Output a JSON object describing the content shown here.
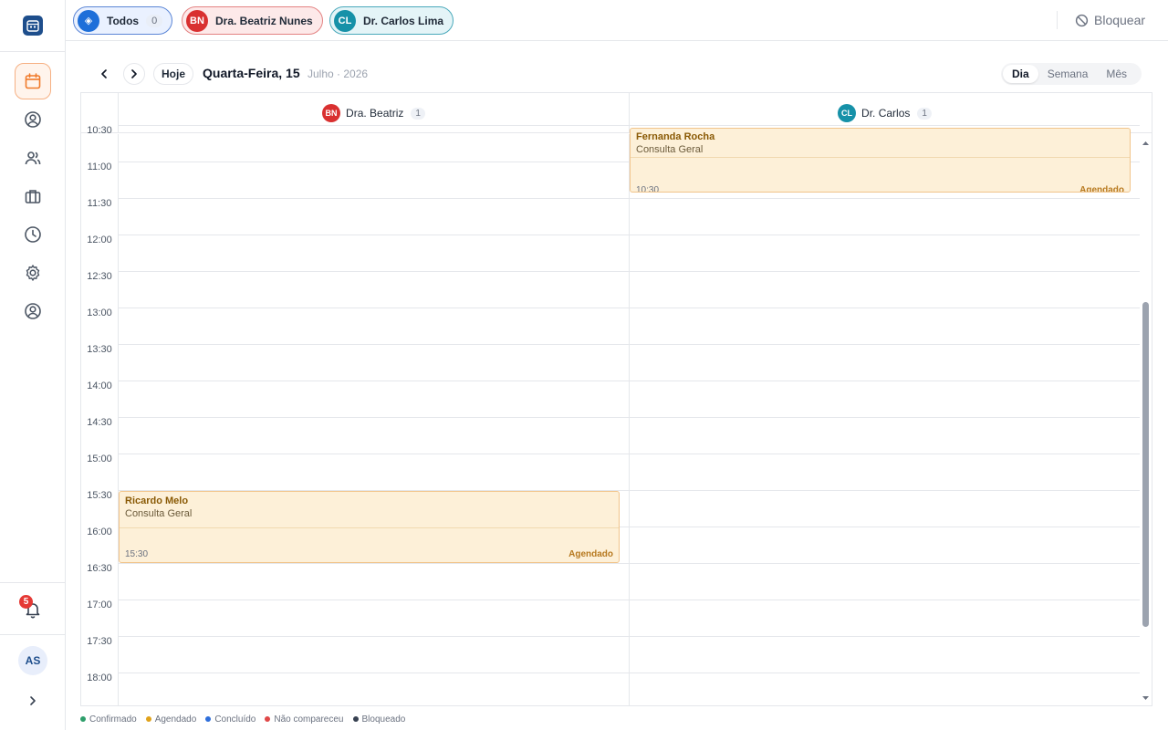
{
  "sidebar": {
    "notifications_count": "5",
    "user_initials": "AS"
  },
  "filters": [
    {
      "label": "Todos",
      "count": "0",
      "avatar": "◈",
      "color": "#1e6fd9",
      "border": "#5b86d6",
      "bg": "#eaf1ff"
    },
    {
      "label": "Dra. Beatriz Nunes",
      "avatar": "BN",
      "color": "#d93030",
      "border": "#e38383",
      "bg": "#fde9e9"
    },
    {
      "label": "Dr. Carlos Lima",
      "avatar": "CL",
      "color": "#1691a8",
      "border": "#4aa9bb",
      "bg": "#e4f4f7"
    }
  ],
  "block_label": "Bloquear",
  "toolbar": {
    "today": "Hoje",
    "date_main": "Quarta-Feira, 15",
    "date_sub": "Julho · 2026",
    "views": [
      "Dia",
      "Semana",
      "Mês"
    ],
    "active_view": "Dia"
  },
  "columns": [
    {
      "initials": "BN",
      "name": "Dra. Beatriz",
      "count": "1",
      "color": "#d93030"
    },
    {
      "initials": "CL",
      "name": "Dr. Carlos",
      "count": "1",
      "color": "#1691a8"
    }
  ],
  "times": [
    "10:30",
    "11:00",
    "11:30",
    "12:00",
    "12:30",
    "13:00",
    "13:30",
    "14:00",
    "14:30",
    "15:00",
    "15:30",
    "16:00",
    "16:30",
    "17:00",
    "17:30",
    "18:00"
  ],
  "events": [
    {
      "patient": "Fernanda Rocha",
      "type": "Consulta Geral",
      "time": "10:30",
      "status": "Agendado",
      "column": 1
    },
    {
      "patient": "Ricardo Melo",
      "type": "Consulta Geral",
      "time": "15:30",
      "status": "Agendado",
      "column": 0
    }
  ],
  "legend": [
    {
      "label": "Confirmado",
      "color": "#2e9e6b"
    },
    {
      "label": "Agendado",
      "color": "#e0a21b"
    },
    {
      "label": "Concluído",
      "color": "#2f6fdb"
    },
    {
      "label": "Não compareceu",
      "color": "#e04848"
    },
    {
      "label": "Bloqueado",
      "color": "#374151"
    }
  ]
}
